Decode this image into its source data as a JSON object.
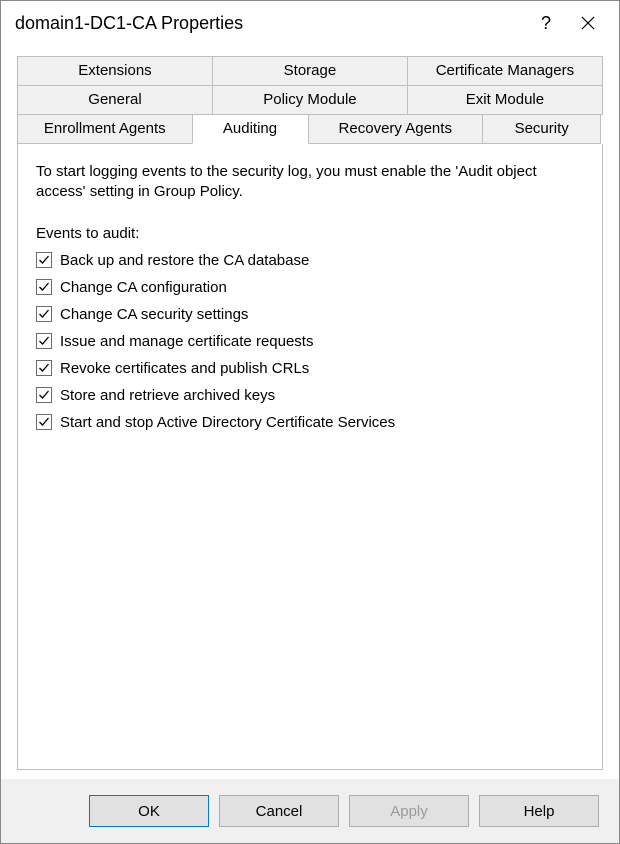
{
  "title": "domain1-DC1-CA Properties",
  "tabs": {
    "row1": [
      "Extensions",
      "Storage",
      "Certificate Managers"
    ],
    "row2": [
      "General",
      "Policy Module",
      "Exit Module"
    ],
    "row3": [
      "Enrollment Agents",
      "Auditing",
      "Recovery Agents",
      "Security"
    ]
  },
  "active_tab": "Auditing",
  "intro": "To start logging events to the security log, you must enable the 'Audit object access' setting in Group Policy.",
  "section_label": "Events to audit:",
  "checks": [
    {
      "label": "Back up and restore the CA database",
      "checked": true
    },
    {
      "label": "Change CA configuration",
      "checked": true
    },
    {
      "label": "Change CA security settings",
      "checked": true
    },
    {
      "label": "Issue and manage certificate requests",
      "checked": true
    },
    {
      "label": "Revoke certificates and publish CRLs",
      "checked": true
    },
    {
      "label": "Store and retrieve archived keys",
      "checked": true
    },
    {
      "label": "Start and stop Active Directory Certificate Services",
      "checked": true
    }
  ],
  "buttons": {
    "ok": "OK",
    "cancel": "Cancel",
    "apply": "Apply",
    "help": "Help"
  }
}
